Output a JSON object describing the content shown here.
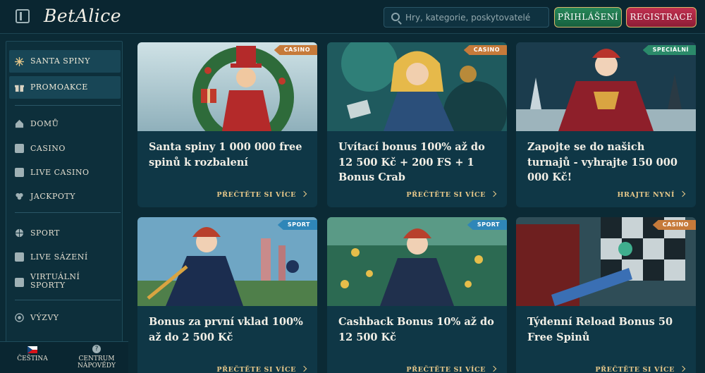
{
  "header": {
    "logo": "BetAlice",
    "search_placeholder": "Hry, kategorie, poskytovatelé",
    "login_label": "PŘIHLÁŠENÍ",
    "register_label": "REGISTRACE"
  },
  "sidebar": {
    "featured": [
      {
        "label": "SANTA SPINY",
        "icon": "snowflake-icon"
      },
      {
        "label": "PROMOAKCE",
        "icon": "gift-icon"
      }
    ],
    "items": [
      {
        "label": "DOMŮ",
        "icon": "home-icon"
      },
      {
        "label": "CASINO",
        "icon": "slot-machine-icon"
      },
      {
        "label": "LIVE CASINO",
        "icon": "cards-icon"
      },
      {
        "label": "JACKPOTY",
        "icon": "clover-icon"
      },
      {
        "label": "SPORT",
        "icon": "ball-icon"
      },
      {
        "label": "LIVE SÁZENÍ",
        "icon": "live-icon"
      },
      {
        "label": "VIRTUÁLNÍ SPORTY",
        "icon": "virtual-icon"
      },
      {
        "label": "VÝZVY",
        "icon": "target-icon"
      }
    ],
    "footer": {
      "language": "ČEŠTINA",
      "help": "CENTRUM NÁPOVĚDY"
    }
  },
  "promos": [
    {
      "badge": "CASINO",
      "badge_type": "casino",
      "title": "Santa spiny 1 000 000 free spinů k rozbalení",
      "cta": "PŘEČTĚTE SI VÍCE"
    },
    {
      "badge": "CASINO",
      "badge_type": "casino",
      "title": "Uvítací bonus 100% až do 12 500 Kč + 200 FS + 1 Bonus Crab",
      "cta": "PŘEČTĚTE SI VÍCE"
    },
    {
      "badge": "SPECIÁLNÍ",
      "badge_type": "special",
      "title": "Zapojte se do našich turnajů - vyhrajte 150 000 000 Kč!",
      "cta": "HRAJTE NYNÍ"
    },
    {
      "badge": "SPORT",
      "badge_type": "sport",
      "title": "Bonus za první vklad 100% až do 2 500 Kč",
      "cta": "PŘEČTĚTE SI VÍCE"
    },
    {
      "badge": "SPORT",
      "badge_type": "sport",
      "title": "Cashback Bonus 10% až do 12 500 Kč",
      "cta": "PŘEČTĚTE SI VÍCE"
    },
    {
      "badge": "CASINO",
      "badge_type": "casino",
      "title": "Týdenní Reload Bonus 50 Free Spinů",
      "cta": "PŘEČTĚTE SI VÍCE"
    }
  ]
}
